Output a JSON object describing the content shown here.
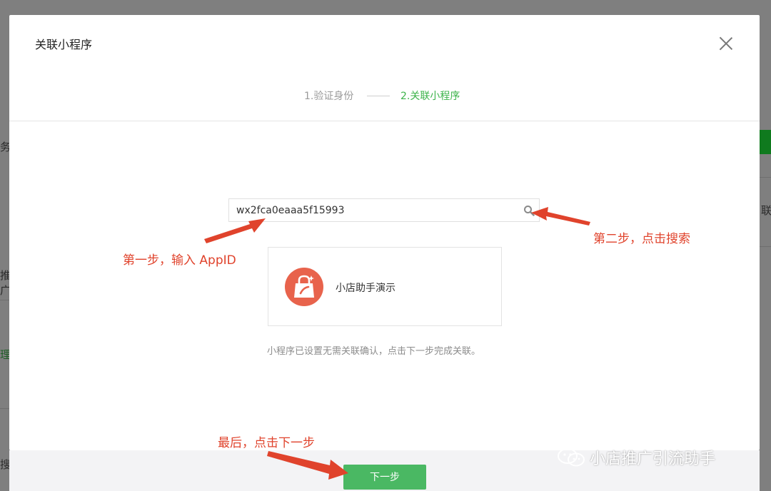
{
  "modal": {
    "title": "关联小程序",
    "steps": {
      "step1": "1.验证身份",
      "step2": "2.关联小程序"
    },
    "search": {
      "value": "wx2fca0eaaa5f15993"
    },
    "app_card": {
      "name": "小店助手演示"
    },
    "hint": "小程序已设置无需关联确认，点击下一步完成关联。",
    "next_button": "下一步"
  },
  "background": {
    "edge_texts": [
      "务",
      "联",
      "推广",
      "理",
      "搜"
    ]
  },
  "annotations": {
    "step_one": "第一步，输入 AppID",
    "step_two": "第二步，点击搜索",
    "final": "最后，点击下一步"
  },
  "watermark": {
    "text": "小店推广引流助手",
    "icon": "wechat-icon"
  },
  "colors": {
    "accent_green": "#3cb34a",
    "button_green": "#4ab863",
    "annotation_red": "#e0432c"
  }
}
